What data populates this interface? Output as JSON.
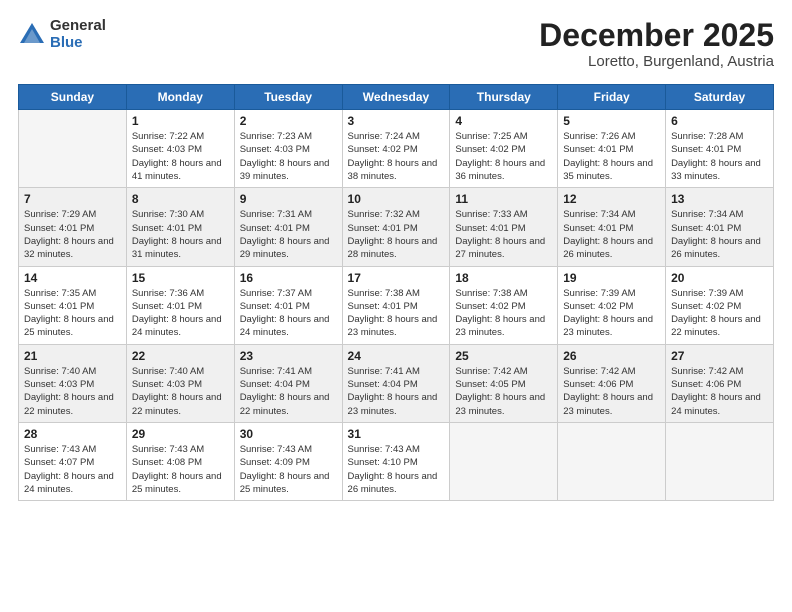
{
  "header": {
    "logo_general": "General",
    "logo_blue": "Blue",
    "month_title": "December 2025",
    "subtitle": "Loretto, Burgenland, Austria"
  },
  "weekdays": [
    "Sunday",
    "Monday",
    "Tuesday",
    "Wednesday",
    "Thursday",
    "Friday",
    "Saturday"
  ],
  "weeks": [
    [
      {
        "day": "",
        "empty": true
      },
      {
        "day": "1",
        "sunrise": "Sunrise: 7:22 AM",
        "sunset": "Sunset: 4:03 PM",
        "daylight": "Daylight: 8 hours and 41 minutes."
      },
      {
        "day": "2",
        "sunrise": "Sunrise: 7:23 AM",
        "sunset": "Sunset: 4:03 PM",
        "daylight": "Daylight: 8 hours and 39 minutes."
      },
      {
        "day": "3",
        "sunrise": "Sunrise: 7:24 AM",
        "sunset": "Sunset: 4:02 PM",
        "daylight": "Daylight: 8 hours and 38 minutes."
      },
      {
        "day": "4",
        "sunrise": "Sunrise: 7:25 AM",
        "sunset": "Sunset: 4:02 PM",
        "daylight": "Daylight: 8 hours and 36 minutes."
      },
      {
        "day": "5",
        "sunrise": "Sunrise: 7:26 AM",
        "sunset": "Sunset: 4:01 PM",
        "daylight": "Daylight: 8 hours and 35 minutes."
      },
      {
        "day": "6",
        "sunrise": "Sunrise: 7:28 AM",
        "sunset": "Sunset: 4:01 PM",
        "daylight": "Daylight: 8 hours and 33 minutes."
      }
    ],
    [
      {
        "day": "7",
        "sunrise": "Sunrise: 7:29 AM",
        "sunset": "Sunset: 4:01 PM",
        "daylight": "Daylight: 8 hours and 32 minutes."
      },
      {
        "day": "8",
        "sunrise": "Sunrise: 7:30 AM",
        "sunset": "Sunset: 4:01 PM",
        "daylight": "Daylight: 8 hours and 31 minutes."
      },
      {
        "day": "9",
        "sunrise": "Sunrise: 7:31 AM",
        "sunset": "Sunset: 4:01 PM",
        "daylight": "Daylight: 8 hours and 29 minutes."
      },
      {
        "day": "10",
        "sunrise": "Sunrise: 7:32 AM",
        "sunset": "Sunset: 4:01 PM",
        "daylight": "Daylight: 8 hours and 28 minutes."
      },
      {
        "day": "11",
        "sunrise": "Sunrise: 7:33 AM",
        "sunset": "Sunset: 4:01 PM",
        "daylight": "Daylight: 8 hours and 27 minutes."
      },
      {
        "day": "12",
        "sunrise": "Sunrise: 7:34 AM",
        "sunset": "Sunset: 4:01 PM",
        "daylight": "Daylight: 8 hours and 26 minutes."
      },
      {
        "day": "13",
        "sunrise": "Sunrise: 7:34 AM",
        "sunset": "Sunset: 4:01 PM",
        "daylight": "Daylight: 8 hours and 26 minutes."
      }
    ],
    [
      {
        "day": "14",
        "sunrise": "Sunrise: 7:35 AM",
        "sunset": "Sunset: 4:01 PM",
        "daylight": "Daylight: 8 hours and 25 minutes."
      },
      {
        "day": "15",
        "sunrise": "Sunrise: 7:36 AM",
        "sunset": "Sunset: 4:01 PM",
        "daylight": "Daylight: 8 hours and 24 minutes."
      },
      {
        "day": "16",
        "sunrise": "Sunrise: 7:37 AM",
        "sunset": "Sunset: 4:01 PM",
        "daylight": "Daylight: 8 hours and 24 minutes."
      },
      {
        "day": "17",
        "sunrise": "Sunrise: 7:38 AM",
        "sunset": "Sunset: 4:01 PM",
        "daylight": "Daylight: 8 hours and 23 minutes."
      },
      {
        "day": "18",
        "sunrise": "Sunrise: 7:38 AM",
        "sunset": "Sunset: 4:02 PM",
        "daylight": "Daylight: 8 hours and 23 minutes."
      },
      {
        "day": "19",
        "sunrise": "Sunrise: 7:39 AM",
        "sunset": "Sunset: 4:02 PM",
        "daylight": "Daylight: 8 hours and 23 minutes."
      },
      {
        "day": "20",
        "sunrise": "Sunrise: 7:39 AM",
        "sunset": "Sunset: 4:02 PM",
        "daylight": "Daylight: 8 hours and 22 minutes."
      }
    ],
    [
      {
        "day": "21",
        "sunrise": "Sunrise: 7:40 AM",
        "sunset": "Sunset: 4:03 PM",
        "daylight": "Daylight: 8 hours and 22 minutes."
      },
      {
        "day": "22",
        "sunrise": "Sunrise: 7:40 AM",
        "sunset": "Sunset: 4:03 PM",
        "daylight": "Daylight: 8 hours and 22 minutes."
      },
      {
        "day": "23",
        "sunrise": "Sunrise: 7:41 AM",
        "sunset": "Sunset: 4:04 PM",
        "daylight": "Daylight: 8 hours and 22 minutes."
      },
      {
        "day": "24",
        "sunrise": "Sunrise: 7:41 AM",
        "sunset": "Sunset: 4:04 PM",
        "daylight": "Daylight: 8 hours and 23 minutes."
      },
      {
        "day": "25",
        "sunrise": "Sunrise: 7:42 AM",
        "sunset": "Sunset: 4:05 PM",
        "daylight": "Daylight: 8 hours and 23 minutes."
      },
      {
        "day": "26",
        "sunrise": "Sunrise: 7:42 AM",
        "sunset": "Sunset: 4:06 PM",
        "daylight": "Daylight: 8 hours and 23 minutes."
      },
      {
        "day": "27",
        "sunrise": "Sunrise: 7:42 AM",
        "sunset": "Sunset: 4:06 PM",
        "daylight": "Daylight: 8 hours and 24 minutes."
      }
    ],
    [
      {
        "day": "28",
        "sunrise": "Sunrise: 7:43 AM",
        "sunset": "Sunset: 4:07 PM",
        "daylight": "Daylight: 8 hours and 24 minutes."
      },
      {
        "day": "29",
        "sunrise": "Sunrise: 7:43 AM",
        "sunset": "Sunset: 4:08 PM",
        "daylight": "Daylight: 8 hours and 25 minutes."
      },
      {
        "day": "30",
        "sunrise": "Sunrise: 7:43 AM",
        "sunset": "Sunset: 4:09 PM",
        "daylight": "Daylight: 8 hours and 25 minutes."
      },
      {
        "day": "31",
        "sunrise": "Sunrise: 7:43 AM",
        "sunset": "Sunset: 4:10 PM",
        "daylight": "Daylight: 8 hours and 26 minutes."
      },
      {
        "day": "",
        "empty": true
      },
      {
        "day": "",
        "empty": true
      },
      {
        "day": "",
        "empty": true
      }
    ]
  ]
}
